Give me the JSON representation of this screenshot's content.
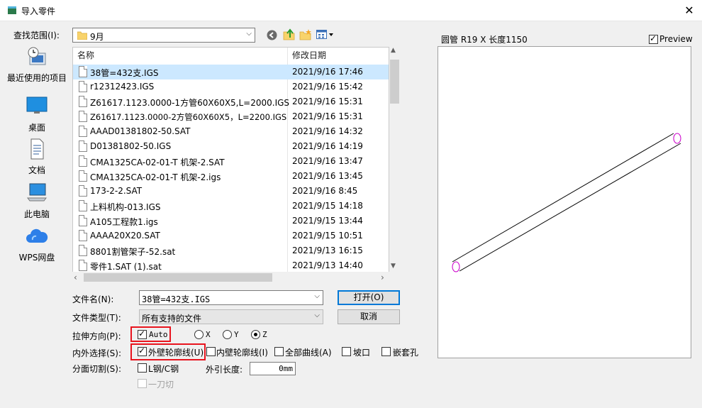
{
  "window": {
    "title": "导入零件",
    "close_glyph": "✕"
  },
  "lookin": {
    "label": "查找范围(I):",
    "value": "9月"
  },
  "places": [
    {
      "label": "最近使用的项目",
      "icon": "recent-items-icon"
    },
    {
      "label": "桌面",
      "icon": "desktop-icon"
    },
    {
      "label": "文档",
      "icon": "documents-icon"
    },
    {
      "label": "此电脑",
      "icon": "computer-icon"
    },
    {
      "label": "WPS网盘",
      "icon": "wps-cloud-icon"
    }
  ],
  "filelist": {
    "col_name": "名称",
    "col_date": "修改日期",
    "rows": [
      {
        "name": "38管=432支.IGS",
        "date": "2021/9/16 17:46",
        "selected": true
      },
      {
        "name": "r12312423.IGS",
        "date": "2021/9/16 15:42"
      },
      {
        "name": "Z61617.1123.0000-1方管60X60X5,L=2000.IGS",
        "date": "2021/9/16 15:31"
      },
      {
        "name": "Z61617.1123.0000-2方管60X60X5，L=2200.IGS",
        "date": "2021/9/16 15:31"
      },
      {
        "name": "AAAD01381802-50.SAT",
        "date": "2021/9/16 14:32"
      },
      {
        "name": "D01381802-50.IGS",
        "date": "2021/9/16 14:19"
      },
      {
        "name": "CMA1325CA-02-01-T 机架-2.SAT",
        "date": "2021/9/16 13:47"
      },
      {
        "name": "CMA1325CA-02-01-T 机架-2.igs",
        "date": "2021/9/16 13:45"
      },
      {
        "name": "173-2-2.SAT",
        "date": "2021/9/16 8:45"
      },
      {
        "name": "上料机构-013.IGS",
        "date": "2021/9/15 14:18"
      },
      {
        "name": "A105工程款1.igs",
        "date": "2021/9/15 13:44"
      },
      {
        "name": "AAAA20X20.SAT",
        "date": "2021/9/15 10:51"
      },
      {
        "name": "8801割管架子-52.sat",
        "date": "2021/9/13 16:15"
      },
      {
        "name": "零件1.SAT (1).sat",
        "date": "2021/9/13 14:40"
      }
    ]
  },
  "filename": {
    "label": "文件名(N):",
    "value": "38管=432支.IGS"
  },
  "filetype": {
    "label": "文件类型(T):",
    "value": "所有支持的文件"
  },
  "buttons": {
    "open": "打开(O)",
    "cancel": "取消"
  },
  "stretch": {
    "label": "拉伸方向(P):",
    "auto": "Auto",
    "auto_checked": true,
    "options": [
      "X",
      "Y",
      "Z"
    ],
    "selected": "Z"
  },
  "inout": {
    "label": "内外选择(S):",
    "outer": "外壁轮廓线(U)",
    "inner": "内壁轮廓线(I)",
    "all": "全部曲线(A)",
    "notch": "坡口",
    "sleeve": "嵌套孔",
    "outer_checked": true
  },
  "cut": {
    "label": "分面切割(S):",
    "lsteel": "L钢/C钢",
    "extend_label": "外引长度:",
    "extend_value": "0mm",
    "onecut": "一刀切"
  },
  "preview": {
    "info": "圆管 R19 X 长度1150",
    "toggle": "Preview",
    "toggle_checked": true
  },
  "colors": {
    "accent": "#0078d7",
    "highlight": "#e8141e",
    "selection": "#cce8ff",
    "tube_end": "#cc00cc"
  }
}
